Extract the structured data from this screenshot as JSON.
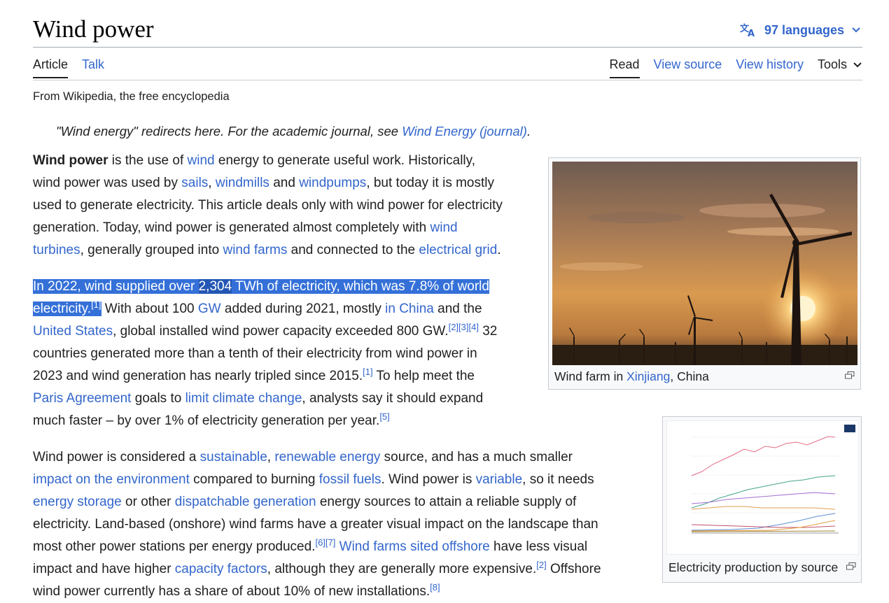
{
  "page": {
    "title": "Wind power",
    "languages": "97 languages",
    "tagline": "From Wikipedia, the free encyclopedia",
    "hatnote": {
      "text": "\"Wind energy\" redirects here. For the academic journal, see ",
      "link": "Wind Energy (journal)",
      "end": "."
    }
  },
  "tabs": {
    "article": "Article",
    "talk": "Talk",
    "read": "Read",
    "view_source": "View source",
    "view_history": "View history",
    "tools": "Tools"
  },
  "p1": {
    "l1a": "Wind power",
    "l1b": " is the use of ",
    "l1c": "wind",
    "l1d": " energy to generate useful work. Historically,",
    "l2a": "wind power was used by ",
    "l2b": "sails",
    "l2c": ", ",
    "l2d": "windmills",
    "l2e": " and ",
    "l2f": "windpumps",
    "l2g": ", but today it is mostly",
    "l3": "used to generate electricity. This article deals only with wind power for electricity",
    "l4a": "generation. Today, wind power is generated almost completely with ",
    "l4b": "wind",
    "l5a": "turbines",
    "l5b": ", generally grouped into ",
    "l5c": "wind farms",
    "l5d": " and connected to the ",
    "l5e": "electrical grid",
    "l5f": "."
  },
  "p2": {
    "l1a": "In 2022, wind supplied over ",
    "l1b": "2,304",
    "l1c": " TWh of electricity, which was 7.8% of world",
    "l2a": "electricity.",
    "l2b": "[1]",
    "l2c": " With about 100 ",
    "l2d": "GW",
    "l2e": " added during 2021, mostly ",
    "l2f": "in China",
    "l2g": " and the",
    "l3a": "United States",
    "l3b": ", global installed wind power capacity exceeded 800 GW.",
    "l3c": "[2][3][4]",
    "l3d": " 32",
    "l4": "countries generated more than a tenth of their electricity from wind power in",
    "l5a": "2023 and wind generation has nearly tripled since 2015.",
    "l5b": "[1]",
    "l5c": " To help meet the",
    "l6a": "Paris Agreement",
    "l6b": " goals to ",
    "l6c": "limit climate change",
    "l6d": ", analysts say it should expand",
    "l7a": "much faster – by over 1% of electricity generation per year.",
    "l7b": "[5]"
  },
  "p3": {
    "l1a": "Wind power is considered a ",
    "l1b": "sustainable",
    "l1c": ", ",
    "l1d": "renewable energy",
    "l1e": " source, and has a much smaller",
    "l2a": "impact on the environment",
    "l2b": " compared to burning ",
    "l2c": "fossil fuels",
    "l2d": ". Wind power is ",
    "l2e": "variable",
    "l2f": ", so it needs",
    "l3a": "energy storage",
    "l3b": " or other ",
    "l3c": "dispatchable generation",
    "l3d": " energy sources to attain a reliable supply of",
    "l4": "electricity. Land-based (onshore) wind farms have a greater visual impact on the landscape than",
    "l5a": "most other power stations per energy produced.",
    "l5b": "[6][7]",
    "l5c": " ",
    "l5d": "Wind farms sited offshore",
    "l5e": " have less visual",
    "l6a": "impact and have higher ",
    "l6b": "capacity factors",
    "l6c": ", although they are generally more expensive.",
    "l6d": "[2]",
    "l6e": " Offshore",
    "l7a": "wind power currently has a share of about 10% of new installations.",
    "l7b": "[8]"
  },
  "figure1": {
    "caption_a": "Wind farm in ",
    "caption_link": "Xinjiang",
    "caption_b": ", China"
  },
  "figure2": {
    "caption": "Electricity production by source"
  },
  "colors": {
    "link": "#3366cc",
    "selection": "#3470d8",
    "text": "#202122"
  }
}
